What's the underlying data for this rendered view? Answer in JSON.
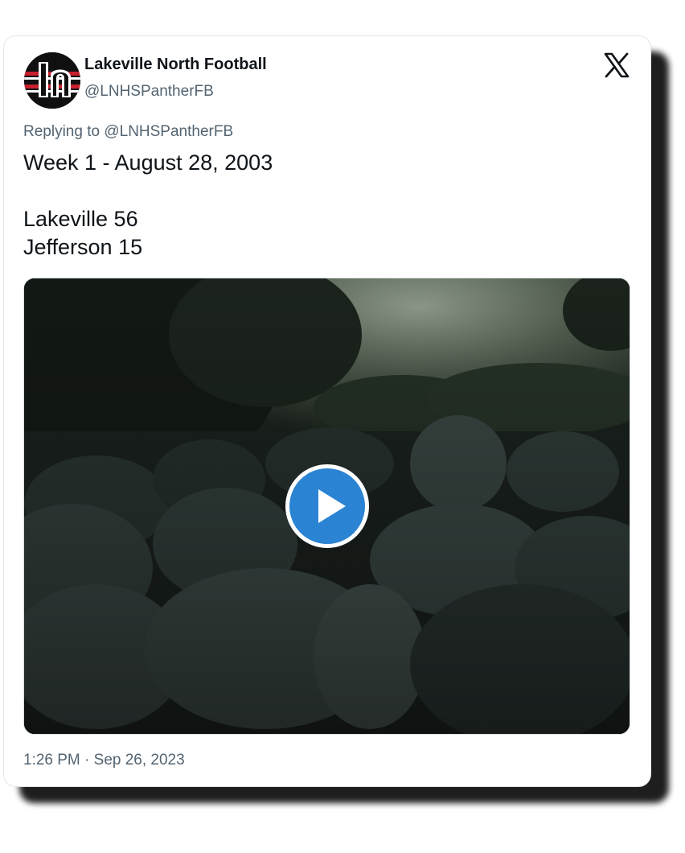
{
  "author": {
    "display_name": "Lakeville North Football",
    "handle": "@LNHSPantherFB",
    "avatar_icon": "lakeville-north-ln-logo",
    "avatar_colors": [
      "#101010",
      "#ffffff",
      "#c8202e"
    ]
  },
  "header": {
    "platform_icon": "x-logo-icon"
  },
  "reply": {
    "text": "Replying to @LNHSPantherFB"
  },
  "tweet": {
    "lines": [
      "Week 1 - August 28, 2003",
      "",
      "Lakeville 56",
      "Jefferson 15"
    ]
  },
  "media": {
    "type": "video",
    "play_icon": "play-icon",
    "play_color": "#2b84d3"
  },
  "footer": {
    "timestamp": "1:26 PM · Sep 26, 2023"
  }
}
